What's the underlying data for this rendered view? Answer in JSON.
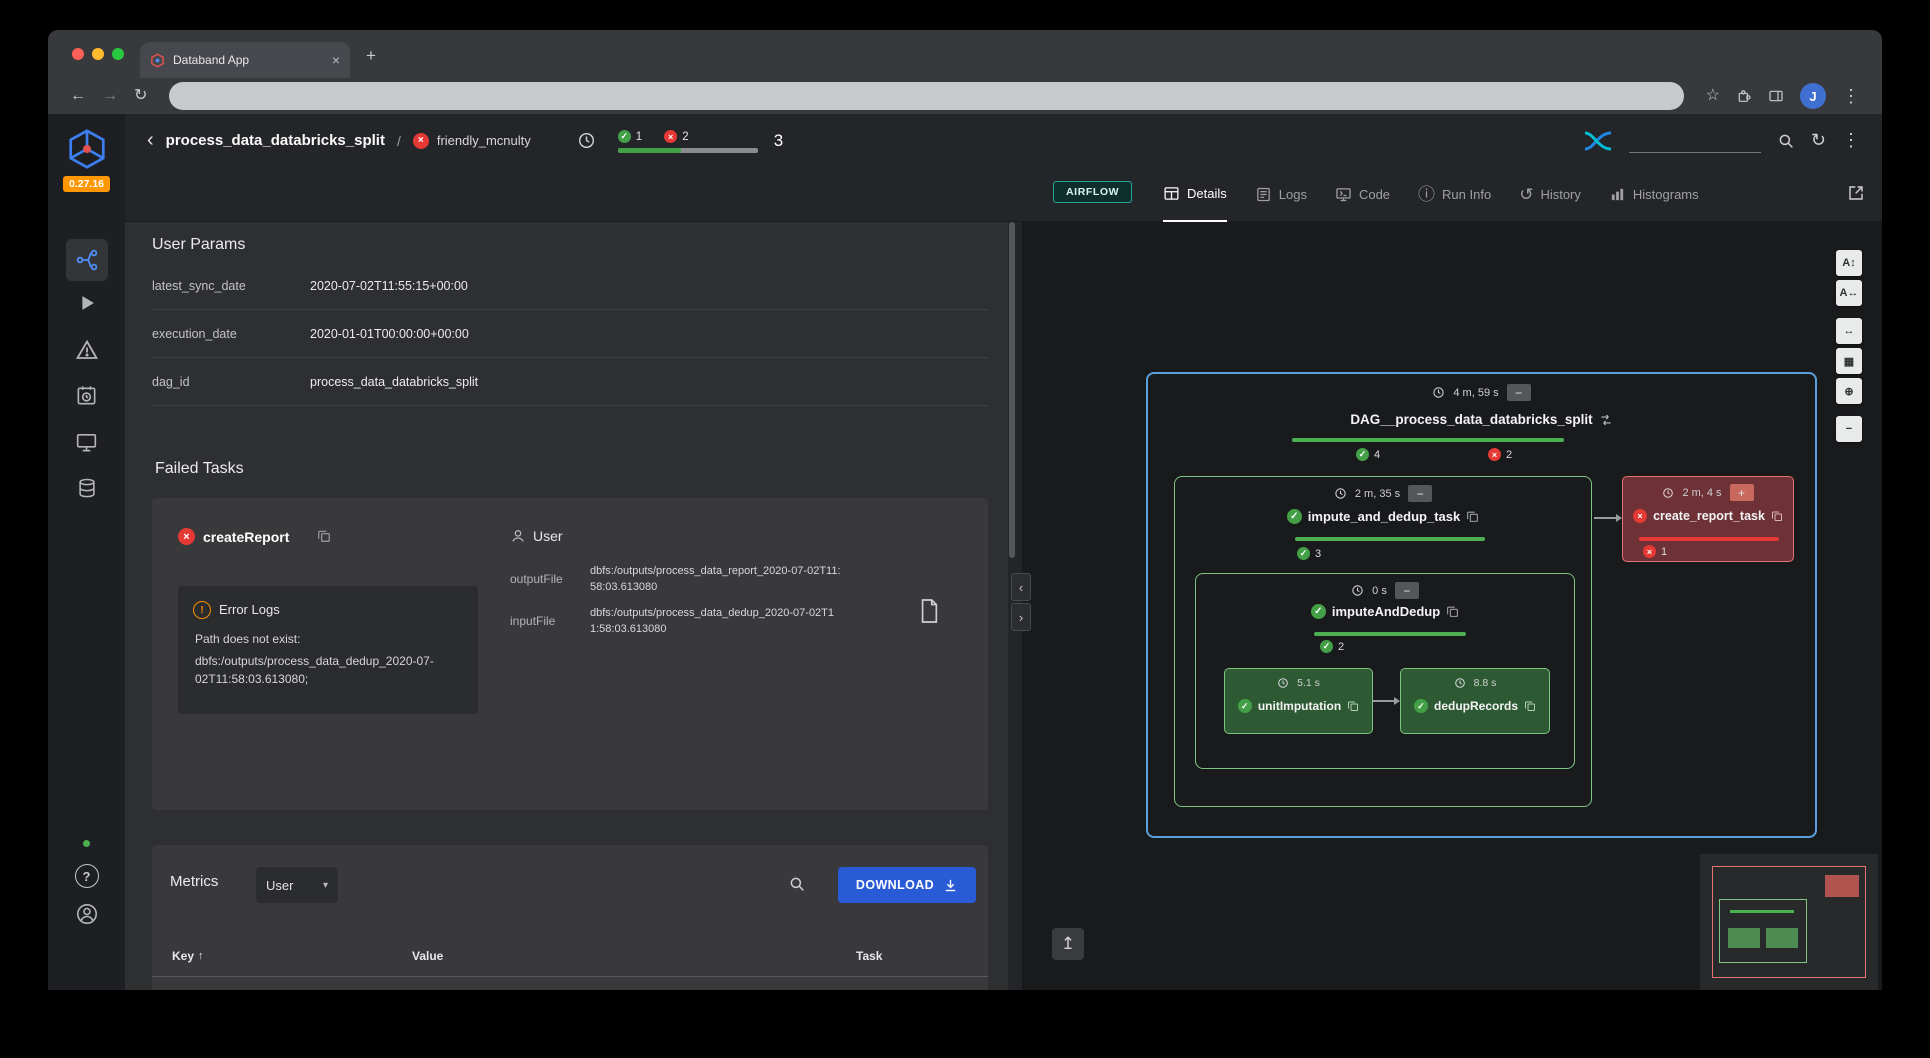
{
  "browser": {
    "tab_title": "Databand App",
    "profile_initial": "J"
  },
  "sidebar": {
    "version": "0.27.16"
  },
  "header": {
    "title": "process_data_databricks_split",
    "separator": "/",
    "run_name": "friendly_mcnulty",
    "passed_count": "1",
    "failed_count": "2",
    "total_count": "3"
  },
  "tabs": {
    "airflow": "AIRFLOW",
    "details": "Details",
    "logs": "Logs",
    "code": "Code",
    "run_info": "Run Info",
    "history": "History",
    "histograms": "Histograms"
  },
  "user_params": {
    "title": "User Params",
    "rows": [
      {
        "key": "latest_sync_date",
        "value": "2020-07-02T11:55:15+00:00"
      },
      {
        "key": "execution_date",
        "value": "2020-01-01T00:00:00+00:00"
      },
      {
        "key": "dag_id",
        "value": "process_data_databricks_split"
      }
    ]
  },
  "failed_tasks": {
    "title": "Failed Tasks",
    "task_name": "createReport",
    "error_title": "Error Logs",
    "error_line1": "Path does not exist:",
    "error_line2": "dbfs:/outputs/process_data_dedup_2020-07-02T11:58:03.613080;",
    "user_title": "User",
    "output_key": "outputFile",
    "output_value": "dbfs:/outputs/process_data_report_2020-07-02T11:58:03.613080",
    "input_key": "inputFile",
    "input_value": "dbfs:/outputs/process_data_dedup_2020-07-02T11:58:03.613080"
  },
  "metrics": {
    "title": "Metrics",
    "filter": "User",
    "download": "DOWNLOAD",
    "col_key": "Key",
    "col_value": "Value",
    "col_task": "Task"
  },
  "graph": {
    "dag": {
      "name": "DAG__process_data_databricks_split",
      "duration": "4 m, 59 s",
      "passed": "4",
      "failed": "2"
    },
    "group": {
      "name": "impute_and_dedup_task",
      "duration": "2 m, 35 s",
      "passed": "3"
    },
    "subgroup": {
      "name": "imputeAndDedup",
      "duration": "0 s",
      "passed": "2"
    },
    "leaf1": {
      "name": "unitImputation",
      "duration": "5.1 s"
    },
    "leaf2": {
      "name": "dedupRecords",
      "duration": "8.8 s"
    },
    "failed_node": {
      "name": "create_report_task",
      "duration": "2 m, 4 s",
      "failed": "1"
    }
  },
  "icons": {
    "check": "✓",
    "cross": "×",
    "warning_mark": "!",
    "back_arrow": "←",
    "forward_arrow": "→",
    "reload": "↻",
    "star": "☆",
    "dots_vertical": "⋮",
    "plus": "+",
    "minus": "−",
    "chevron_left": "‹",
    "chevron_right": "›",
    "caret_down": "▾",
    "sort_up": "↑",
    "history": "↺",
    "info": "ⓘ",
    "question_mark": "?",
    "expand_up": "↥",
    "tab_close": "×",
    "new_tab": "+",
    "toolbar_icons": [
      "A↕",
      "A↔",
      "↔",
      "▦",
      "⊕",
      "−"
    ]
  },
  "colors": {
    "accent_blue": "#2a5bd7",
    "green": "#43a047",
    "red": "#e53935",
    "orange": "#fb8c00",
    "graph_blue_border": "#5a9fe0",
    "graph_green_border": "#7cc47f",
    "graph_red_border": "#e57373",
    "version_badge": "#ff9800"
  }
}
